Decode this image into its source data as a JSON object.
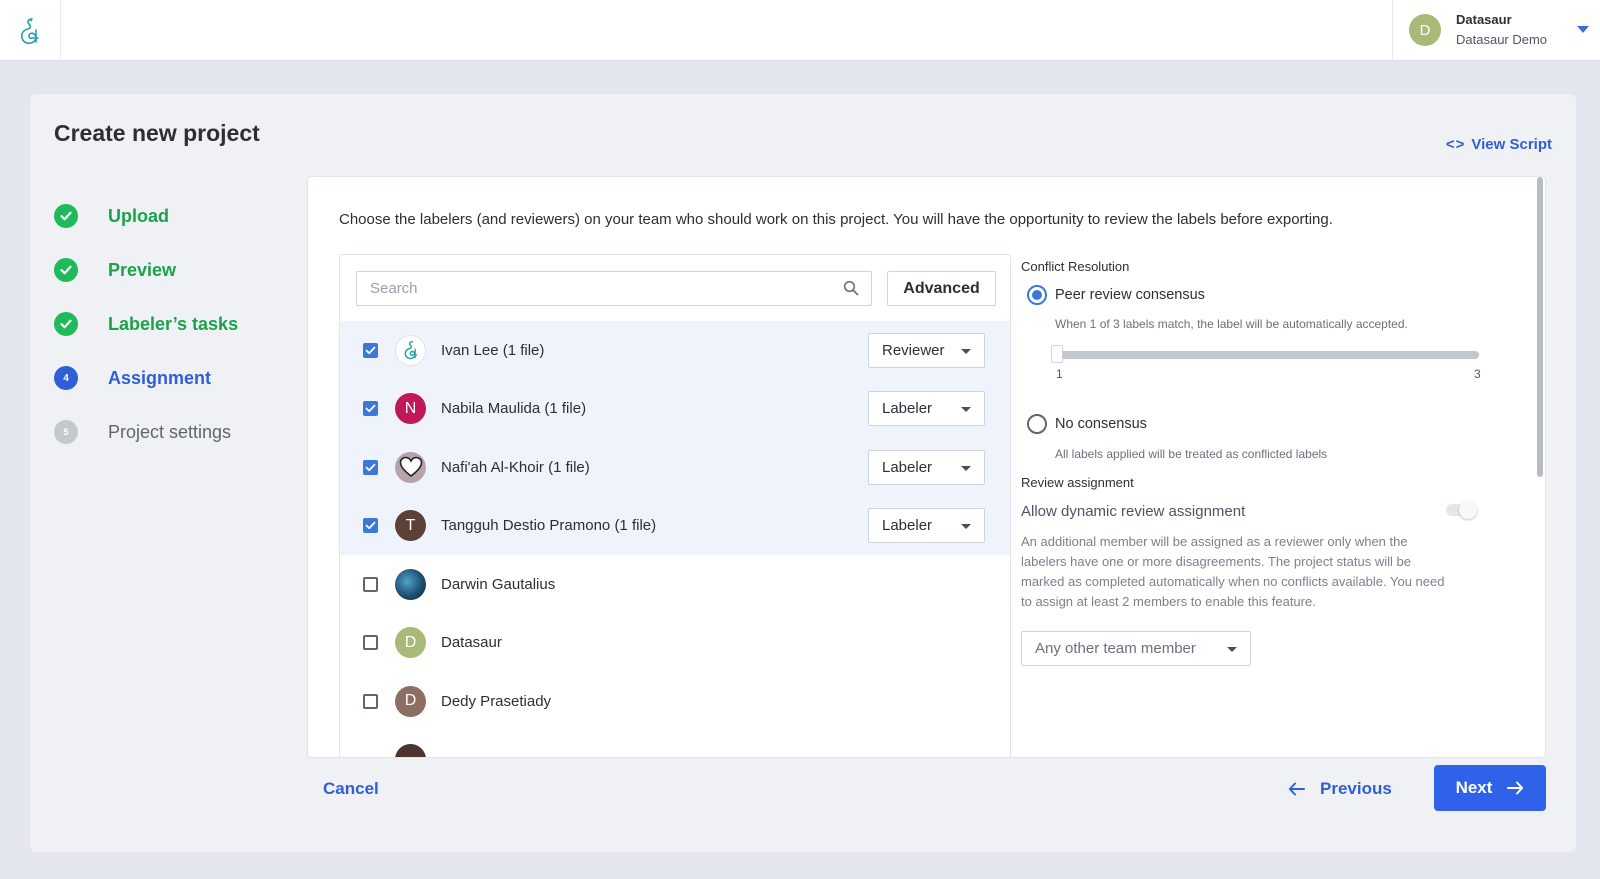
{
  "header": {
    "account_name": "Datasaur",
    "account_team": "Datasaur Demo",
    "avatar_initial": "D"
  },
  "page": {
    "title": "Create new project",
    "view_script": "View Script"
  },
  "steps": [
    {
      "label": "Upload",
      "state": "done"
    },
    {
      "label": "Preview",
      "state": "done"
    },
    {
      "label": "Labeler’s tasks",
      "state": "done"
    },
    {
      "label": "Assignment",
      "state": "current",
      "number": "4"
    },
    {
      "label": "Project settings",
      "state": "todo",
      "number": "5"
    }
  ],
  "assignment": {
    "description": "Choose the labelers (and reviewers) on your team who should work on this project. You will have the opportunity to review the labels before exporting.",
    "search_placeholder": "Search",
    "advanced_label": "Advanced",
    "members": [
      {
        "name": "Ivan Lee (1 file)",
        "checked": true,
        "role": "Reviewer",
        "avatar": "logo"
      },
      {
        "name": "Nabila Maulida (1 file)",
        "checked": true,
        "role": "Labeler",
        "avatar_initial": "N",
        "avatar_color": "#c2185b"
      },
      {
        "name": "Nafi'ah Al-Khoir (1 file)",
        "checked": true,
        "role": "Labeler",
        "avatar": "heart"
      },
      {
        "name": "Tangguh Destio Pramono (1 file)",
        "checked": true,
        "role": "Labeler",
        "avatar_initial": "T",
        "avatar_color": "#5d4037"
      },
      {
        "name": "Darwin Gautalius",
        "checked": false,
        "avatar": "photo"
      },
      {
        "name": "Datasaur",
        "checked": false,
        "avatar_initial": "D",
        "avatar_color": "#a9ba78"
      },
      {
        "name": "Dedy Prasetiady",
        "checked": false,
        "avatar_initial": "D",
        "avatar_color": "#8d6e63"
      }
    ]
  },
  "conflict_resolution": {
    "title": "Conflict Resolution",
    "peer_review_label": "Peer review consensus",
    "peer_review_hint": "When 1 of 3 labels match, the label will be automatically accepted.",
    "slider_value": 1,
    "slider_min": "1",
    "slider_max": "3",
    "no_consensus_label": "No consensus",
    "no_consensus_hint": "All labels applied will be treated as conflicted labels",
    "selected": "peer_review"
  },
  "review_assignment": {
    "title": "Review assignment",
    "toggle_label": "Allow dynamic review assignment",
    "toggle_on": false,
    "description": "An additional member will be assigned as a reviewer only when the labelers have one or more disagreements. The project status will be marked as completed automatically when no conflicts available. You need to assign at least 2 members to enable this feature.",
    "member_select": "Any other team member"
  },
  "footer": {
    "cancel": "Cancel",
    "previous": "Previous",
    "next": "Next"
  },
  "colors": {
    "accent": "#2f5ed6",
    "success": "#1fba5a",
    "checkbox": "#3c78d8"
  }
}
